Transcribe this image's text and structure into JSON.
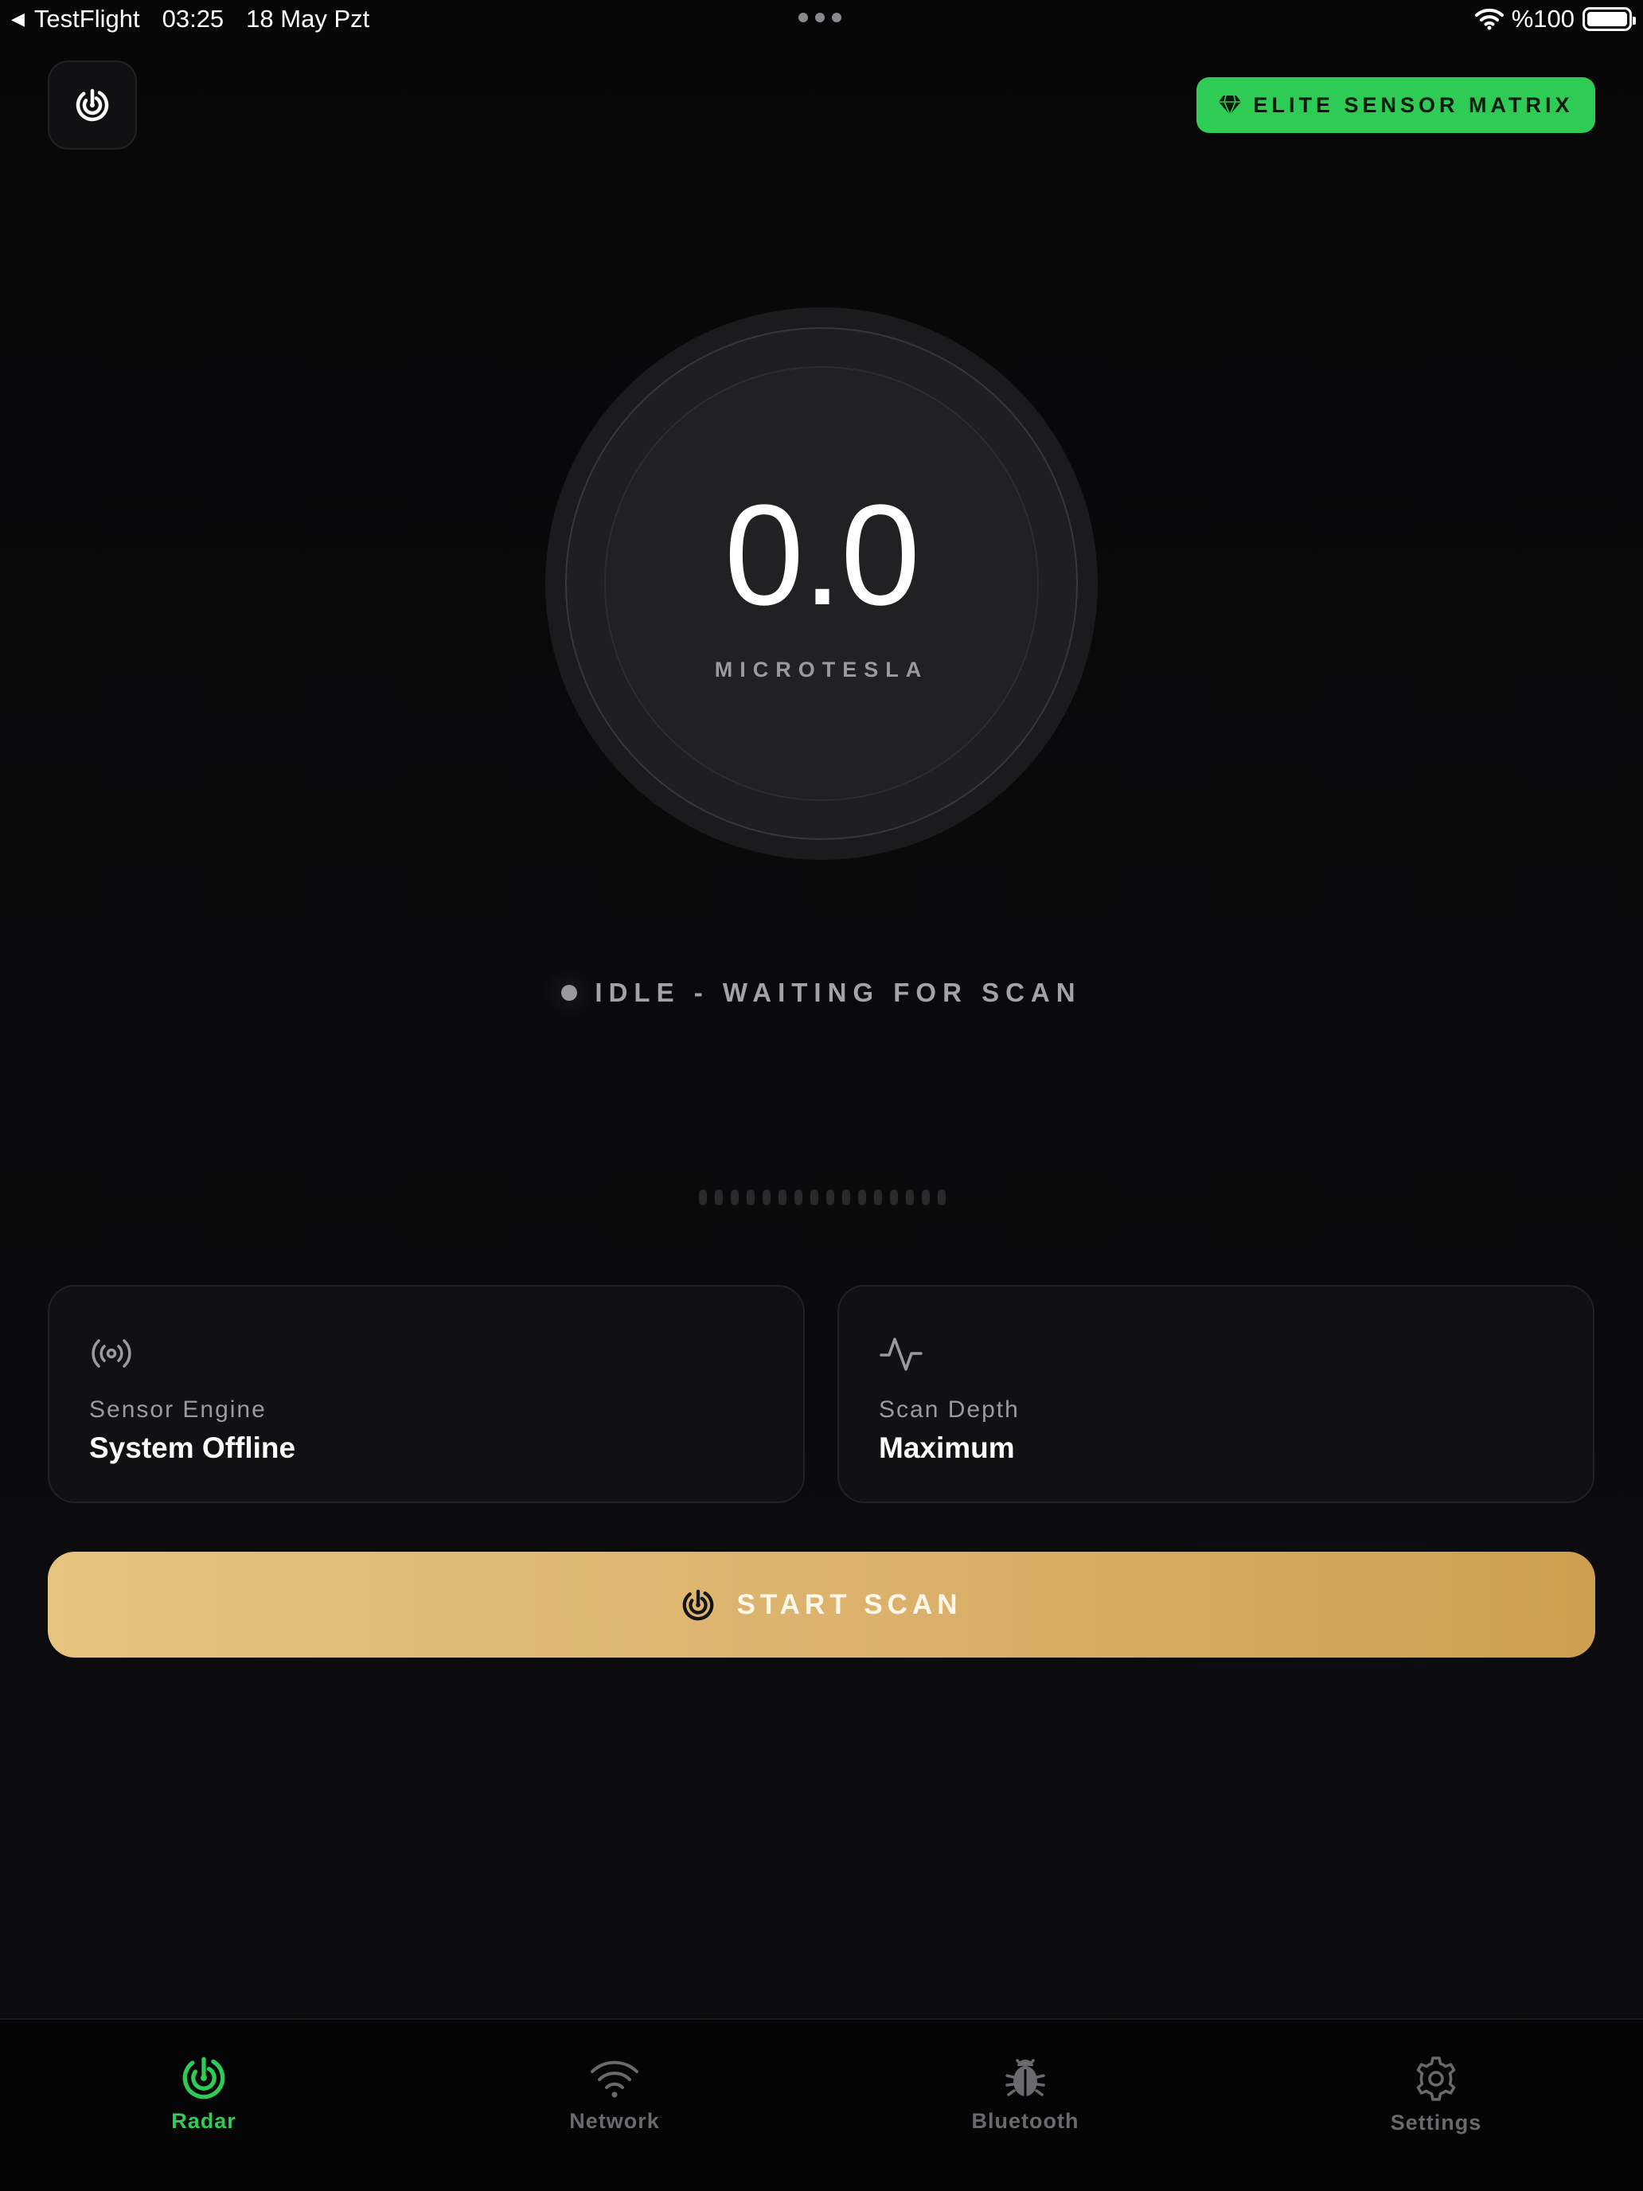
{
  "status_bar": {
    "back_glyph": "◀",
    "app": "TestFlight",
    "time": "03:25",
    "date": "18 May Pzt",
    "battery": "%100"
  },
  "header": {
    "radar_button_icon": "radar-icon",
    "elite_button_icon": "diamond-icon",
    "elite_button_label": "ELITE SENSOR MATRIX"
  },
  "gauge": {
    "value": "0.0",
    "unit": "MICROTESLA"
  },
  "status": {
    "text": "IDLE - WAITING FOR SCAN"
  },
  "signal_bars_count": 16,
  "cards": [
    {
      "icon": "broadcast-icon",
      "label": "Sensor Engine",
      "value": "System Offline"
    },
    {
      "icon": "activity-icon",
      "label": "Scan Depth",
      "value": "Maximum"
    }
  ],
  "start_button": {
    "icon": "radar-icon",
    "label": "START SCAN"
  },
  "tabs": [
    {
      "label": "Radar",
      "icon": "radar-icon",
      "active": true
    },
    {
      "label": "Network",
      "icon": "wifi-icon",
      "active": false
    },
    {
      "label": "Bluetooth",
      "icon": "bug-icon",
      "active": false
    },
    {
      "label": "Settings",
      "icon": "gear-icon",
      "active": false
    }
  ],
  "colors": {
    "accent_green": "#2ecb55",
    "gold_start": "#e6c37f",
    "gold_end": "#cca04f",
    "background": "#0a0a0b"
  }
}
